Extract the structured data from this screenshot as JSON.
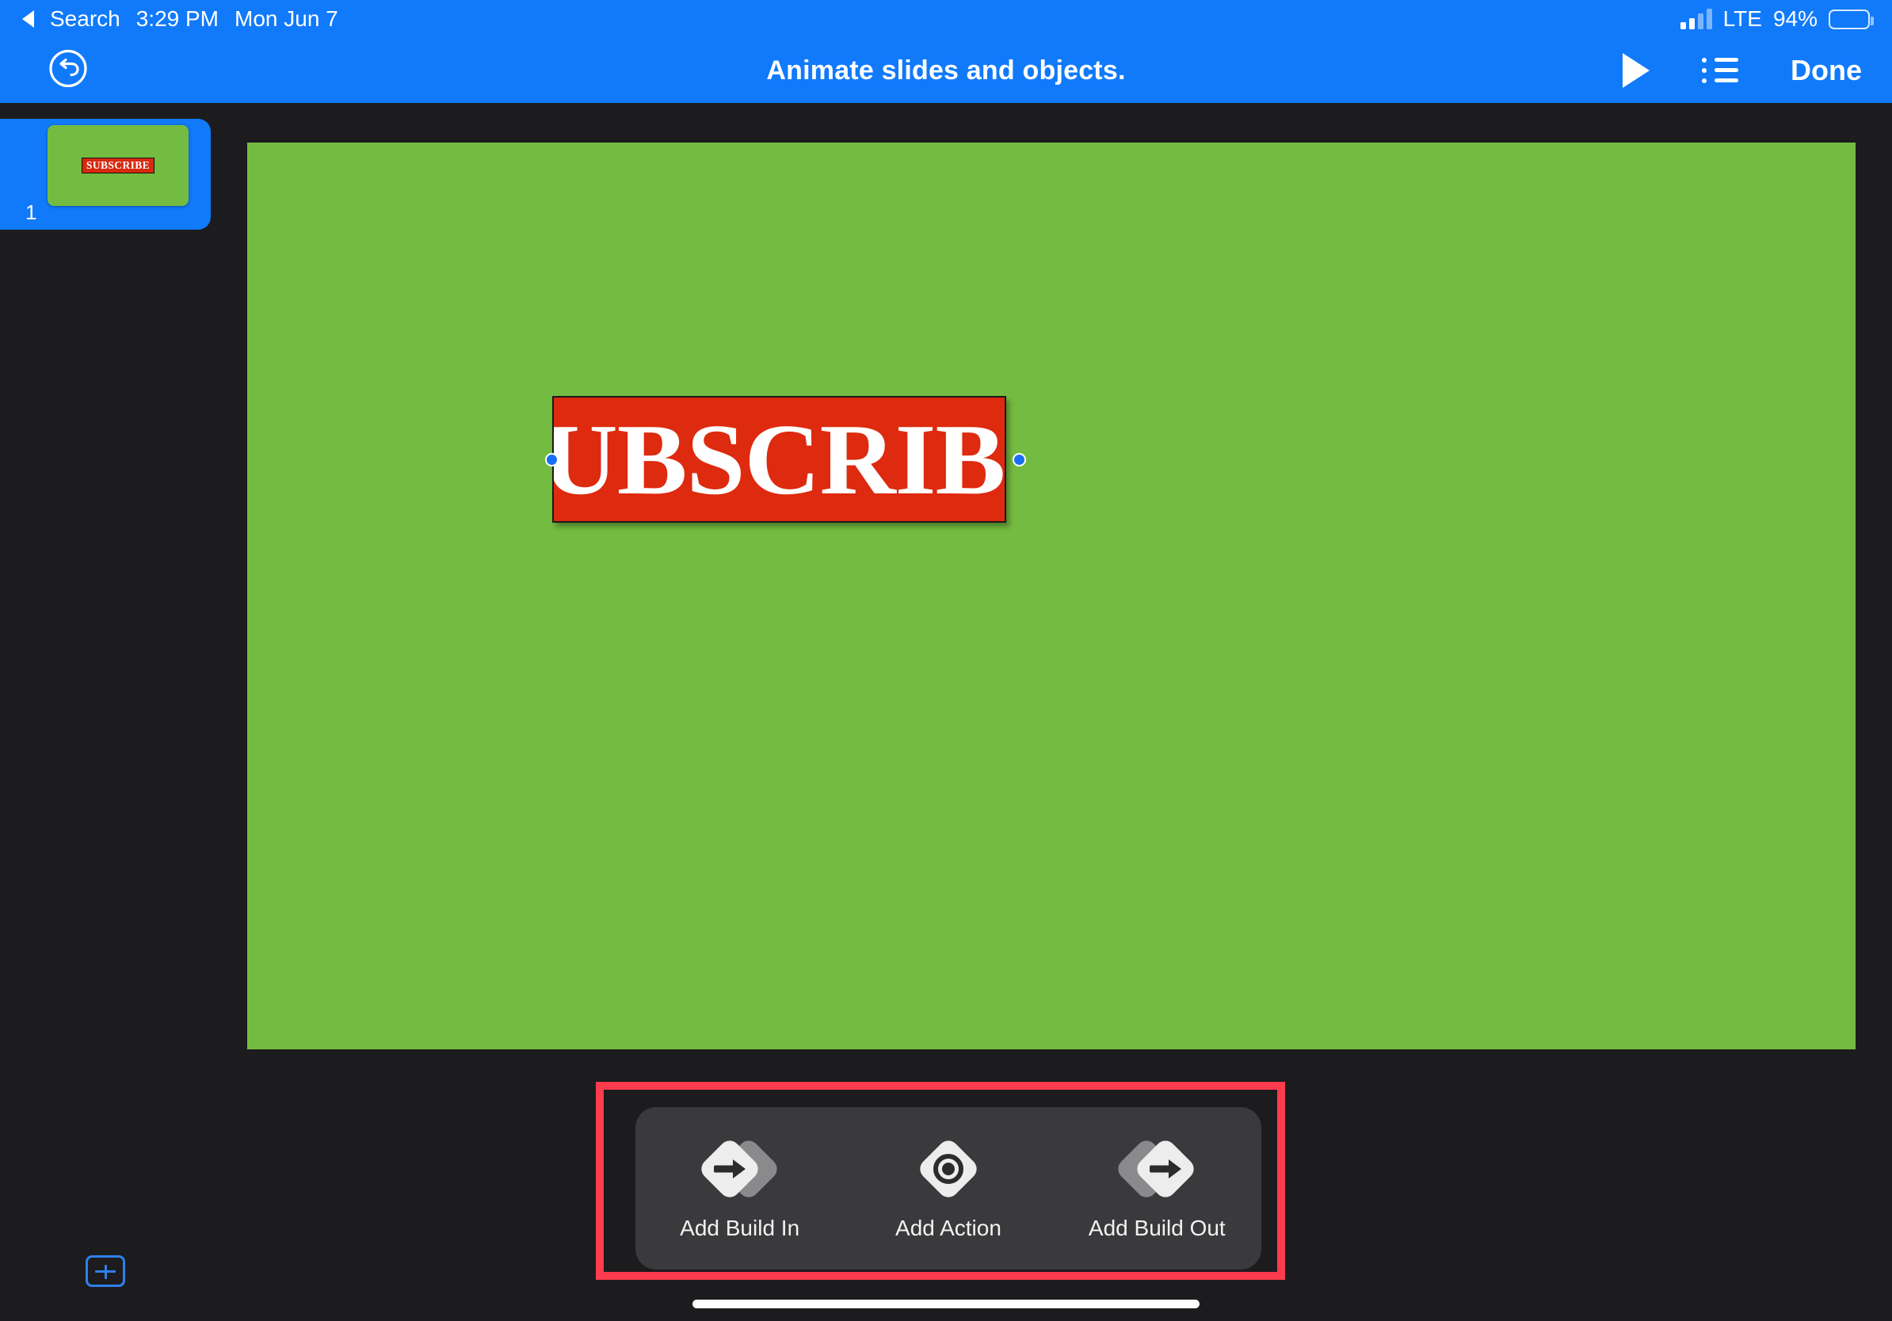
{
  "status_bar": {
    "back_label": "Search",
    "back_icon": "triangle-left-icon",
    "time": "3:29 PM",
    "date": "Mon Jun 7",
    "carrier_network": "LTE",
    "battery_percent": "94%",
    "signal_icon": "cellular-signal-icon",
    "signal_bars_filled": 2,
    "signal_bars_total": 4,
    "battery_icon": "battery-icon",
    "background_color": "#107AFB"
  },
  "nav_bar": {
    "undo_icon": "undo-circle-icon",
    "title": "Animate slides and objects.",
    "play_icon": "play-icon",
    "list_icon": "bulleted-list-icon",
    "done_label": "Done",
    "background_color": "#107AFB"
  },
  "sidebar": {
    "slides": [
      {
        "number": "1",
        "selected": true,
        "background_color": "#74BC41",
        "object_text": "SUBSCRIBE",
        "object_color": "#D8290E"
      }
    ],
    "add_slide_icon": "add-slide-icon",
    "background_color": "#1C1C1E"
  },
  "canvas": {
    "slide_background_color": "#74BC41",
    "object": {
      "text": "SUBSCRIBE",
      "fill_color": "#DE2A0E",
      "text_color": "#FFFFFF",
      "selected": true,
      "handle_color": "#1A6EF5",
      "left_handle_icon": "resize-handle-left-icon",
      "right_handle_icon": "resize-handle-right-icon"
    }
  },
  "animation_toolbar": {
    "highlight_color": "#FF3B4E",
    "background_color": "#3A3A3C",
    "buttons": [
      {
        "label": "Add Build In",
        "icon": "build-in-icon"
      },
      {
        "label": "Add Action",
        "icon": "action-icon"
      },
      {
        "label": "Add Build Out",
        "icon": "build-out-icon"
      }
    ]
  },
  "home_indicator": {
    "icon": "home-indicator"
  }
}
